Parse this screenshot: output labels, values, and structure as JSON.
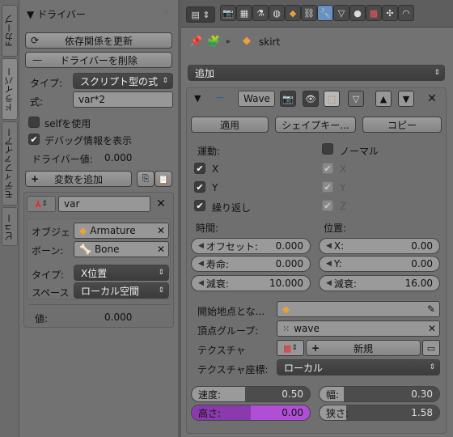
{
  "tabs": [
    "Fカーブ",
    "ドライバー",
    "モディファイアー",
    "ビュー"
  ],
  "driver_panel": {
    "title": "ドライバー",
    "update_deps": "依存関係を更新",
    "remove_driver": "ドライバーを削除",
    "type_label": "タイプ:",
    "type_value": "スクリプト型の式",
    "expr_label": "式:",
    "expr_value": "var*2",
    "use_self": "selfを使用",
    "show_debug": "デバッグ情報を表示",
    "driver_value_label": "ドライバー値:",
    "driver_value": "0.000",
    "add_variable": "変数を追加"
  },
  "variable": {
    "name": "var",
    "object_label": "オブジェ",
    "object_value": "Armature",
    "bone_label": "ボーン:",
    "bone_value": "Bone",
    "type_label": "タイプ:",
    "type_value": "X位置",
    "space_label": "スペース",
    "space_value": "ローカル空間",
    "value_label": "値:",
    "value": "0.000"
  },
  "properties": {
    "breadcrumb_object": "skirt",
    "add_menu": "追加",
    "modifier_name": "Wave",
    "apply": "適用",
    "shapekey": "シェイプキー...",
    "copy": "コピー",
    "motion_label": "運動:",
    "x": "X",
    "y": "Y",
    "cyclic": "繰り返し",
    "normal": "ノーマル",
    "nx": "X",
    "ny": "Y",
    "nz": "Z",
    "time_label": "時間:",
    "position_label": "位置:",
    "offset_label": "オフセット:",
    "offset_value": "0.000",
    "life_label": "寿命:",
    "life_value": "0.000",
    "damp_label": "減衰:",
    "damp_value": "10.000",
    "pos_x_label": "X:",
    "pos_x_value": "0.00",
    "pos_y_label": "Y:",
    "pos_y_value": "0.00",
    "falloff_label": "減衰:",
    "falloff_value": "16.00",
    "start_pos_label": "開始地点とな...",
    "vgroup_label": "頂点グループ:",
    "vgroup_value": "wave",
    "texture_label": "テクスチャ",
    "texture_new": "新規",
    "tex_coords_label": "テクスチャ座標:",
    "tex_coords_value": "ローカル",
    "speed_label": "速度:",
    "speed_value": "0.50",
    "width_label": "幅:",
    "width_value": "0.30",
    "height_label": "高さ:",
    "height_value": "0.00",
    "narrow_label": "狭さ:",
    "narrow_value": "1.58",
    "height_color": "#b04fd6"
  }
}
